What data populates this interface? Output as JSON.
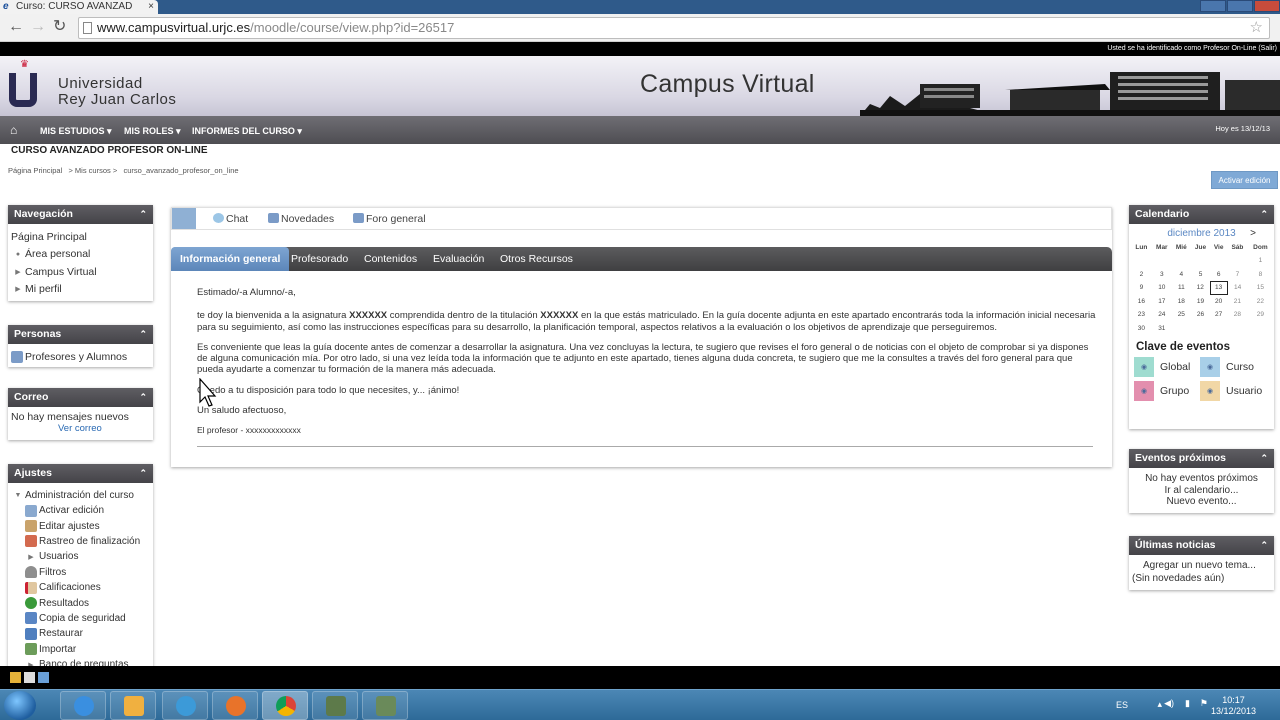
{
  "browser": {
    "tab_title": "Curso: CURSO AVANZAD",
    "tab_close": "×",
    "url_host": "www.campusvirtual.urjc.es",
    "url_path": "/moodle/course/view.php?id=26517"
  },
  "login_info": "Usted se ha identificado como Profesor On-Line (Salir)",
  "banner": {
    "university_line1": "Universidad",
    "university_line2": "Rey Juan Carlos",
    "title": "Campus Virtual"
  },
  "menu": {
    "items": [
      "MIS ESTUDIOS",
      "MIS ROLES",
      "INFORMES DEL CURSO"
    ],
    "date": "Hoy es 13/12/13"
  },
  "course_title": "CURSO AVANZADO PROFESOR ON-LINE",
  "breadcrumb": "Página Principal   > Mis cursos >   curso_avanzado_profesor_on_line",
  "edit_button": "Activar edición",
  "navegacion": {
    "title": "Navegación",
    "items": [
      "Página Principal",
      "Área personal",
      "Campus Virtual",
      "Mi perfil"
    ]
  },
  "personas": {
    "title": "Personas",
    "item": "Profesores y Alumnos"
  },
  "correo": {
    "title": "Correo",
    "text": "No hay mensajes nuevos",
    "link": "Ver correo"
  },
  "ajustes": {
    "title": "Ajustes",
    "admin": "Administración del curso",
    "items": [
      "Activar edición",
      "Editar ajustes",
      "Rastreo de finalización",
      "Usuarios",
      "Filtros",
      "Calificaciones",
      "Resultados",
      "Copia de seguridad",
      "Restaurar",
      "Importar",
      "Banco de preguntas"
    ]
  },
  "activity_bar": {
    "items": [
      "Chat",
      "Novedades",
      "Foro general"
    ]
  },
  "tabs": [
    "Información general",
    "Profesorado",
    "Contenidos",
    "Evaluación",
    "Otros Recursos"
  ],
  "message": {
    "greeting": "Estimado/-a Alumno/-a,",
    "p1_a": "te doy la bienvenida a la asignatura ",
    "p1_b": "XXXXXX",
    "p1_c": " comprendida dentro de la titulación ",
    "p1_d": "XXXXXX",
    "p1_e": " en la que estás matriculado. En la guía docente adjunta en este apartado encontrarás toda la información inicial necesaria para su seguimiento, así como las instrucciones específicas para su desarrollo, la planificación temporal, aspectos relativos a la evaluación o los objetivos de aprendizaje que perseguiremos.",
    "p2": "Es conveniente que leas la guía docente antes de comenzar a desarrollar la asignatura. Una vez concluyas la lectura, te sugiero que revises el foro general o de noticias con el objeto de comprobar si ya dispones de alguna comunicación mía. Por otro lado, si una vez leída toda la información que te adjunto en este apartado, tienes alguna duda concreta, te sugiero que me la consultes a través del foro general para que pueda ayudarte a comenzar tu formación de la manera más adecuada.",
    "p3": "Quedo a tu disposición para todo lo que necesites, y... ¡ánimo!",
    "p4": "Un saludo afectuoso,",
    "sign": "El profesor - xxxxxxxxxxxxx"
  },
  "calendario": {
    "title": "Calendario",
    "month": "diciembre 2013",
    "next": ">",
    "days": [
      "Lun",
      "Mar",
      "Mié",
      "Jue",
      "Vie",
      "Sáb",
      "Dom"
    ],
    "weeks": [
      [
        "",
        "",
        "",
        "",
        "",
        "",
        "1"
      ],
      [
        "2",
        "3",
        "4",
        "5",
        "6",
        "7",
        "8"
      ],
      [
        "9",
        "10",
        "11",
        "12",
        "13",
        "14",
        "15"
      ],
      [
        "16",
        "17",
        "18",
        "19",
        "20",
        "21",
        "22"
      ],
      [
        "23",
        "24",
        "25",
        "26",
        "27",
        "28",
        "29"
      ],
      [
        "30",
        "31",
        "",
        "",
        "",
        "",
        ""
      ]
    ],
    "today": "13",
    "key_title": "Clave de eventos",
    "keys": [
      {
        "label": "Global",
        "color": "#9fdcd0"
      },
      {
        "label": "Curso",
        "color": "#a8cfe8"
      },
      {
        "label": "Grupo",
        "color": "#e38fae"
      },
      {
        "label": "Usuario",
        "color": "#f1d7a6"
      }
    ]
  },
  "eventos": {
    "title": "Eventos próximos",
    "text": "No hay eventos próximos",
    "link1": "Ir al calendario...",
    "link2": "Nuevo evento..."
  },
  "noticias": {
    "title": "Últimas noticias",
    "link": "Agregar un nuevo tema...",
    "text": "(Sin novedades aún)"
  },
  "taskbar": {
    "lang": "ES",
    "time": "10:17",
    "date": "13/12/2013"
  }
}
